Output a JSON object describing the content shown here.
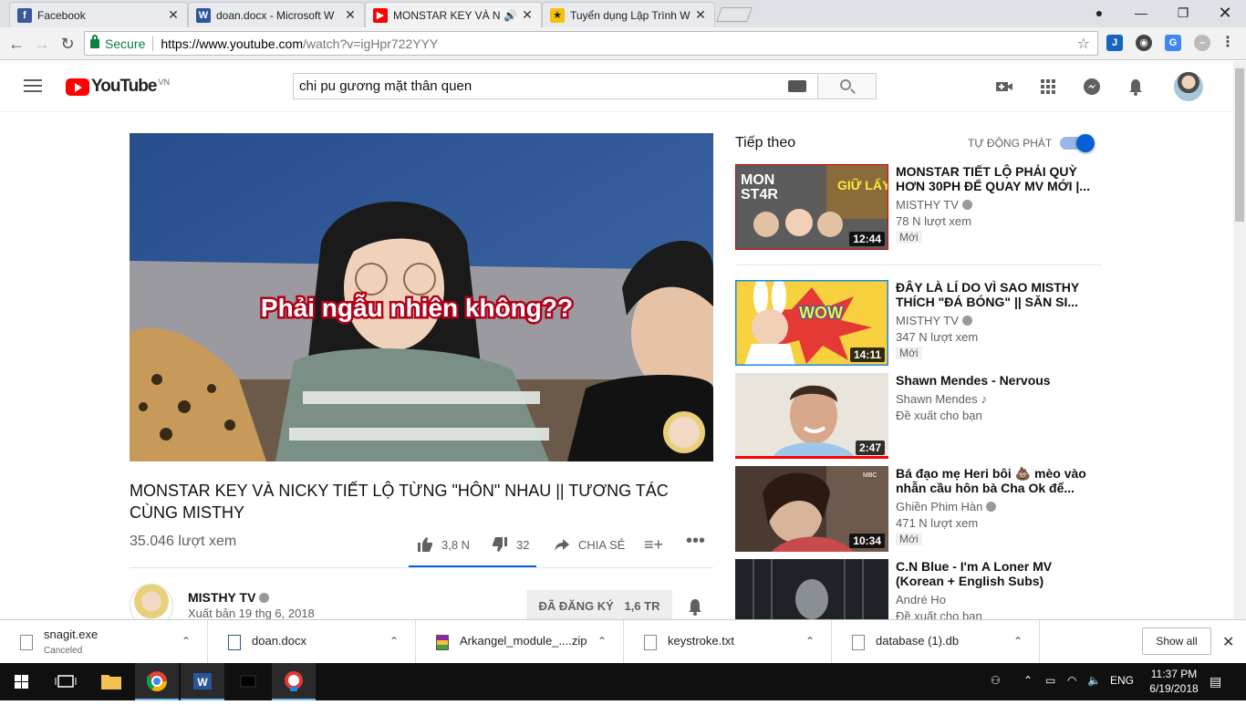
{
  "browser": {
    "tabs": [
      {
        "title": "Facebook",
        "icon": "facebook-icon",
        "color": "#3b5998",
        "active": false
      },
      {
        "title": "doan.docx - Microsoft W",
        "icon": "word-icon",
        "color": "#2b579a",
        "active": false
      },
      {
        "title": "MONSTAR KEY VÀ NIC",
        "icon": "youtube-icon",
        "color": "#ff0000",
        "active": true
      },
      {
        "title": "Tuyển dụng Lập Trình Wi",
        "icon": "jobs-icon",
        "color": "#f4c20d",
        "active": false
      }
    ],
    "secure_label": "Secure",
    "url_host": "https://www.youtube.com",
    "url_rest": "/watch?v=igHpr722YYY"
  },
  "youtube": {
    "logo_text": "YouTube",
    "country": "VN",
    "search_value": "chi pu gương mặt thân quen",
    "video": {
      "overlay_caption": "Phải ngẫu nhiên không??",
      "title": "MONSTAR KEY VÀ NICKY TIẾT LỘ TỪNG \"HÔN\" NHAU || TƯƠNG TÁC CÙNG MISTHY",
      "views": "35.046 lượt xem",
      "likes": "3,8 N",
      "dislikes": "32",
      "share_label": "CHIA SẺ"
    },
    "channel": {
      "name": "MISTHY TV",
      "published": "Xuất bản 19 thg 6, 2018",
      "subscribe_label": "ĐÃ ĐĂNG KÝ",
      "subscribers": "1,6 TR"
    },
    "upnext": {
      "heading": "Tiếp theo",
      "autoplay_label": "TỰ ĐỘNG PHÁT",
      "items": [
        {
          "title": "MONSTAR TIẾT LỘ PHẢI QUỲ HƠN 30PH ĐỂ QUAY MV MỚI |...",
          "channel": "MISTHY TV",
          "meta": "78 N lượt xem",
          "badge": "Mới",
          "duration": "12:44"
        },
        {
          "title": "ĐÂY LÀ LÍ DO VÌ SAO MISTHY THÍCH \"ĐÁ BÓNG\" || SĂN SI...",
          "channel": "MISTHY TV",
          "meta": "347 N lượt xem",
          "badge": "Mới",
          "duration": "14:11"
        },
        {
          "title": "Shawn Mendes - Nervous",
          "channel": "Shawn Mendes",
          "meta": "Đề xuất cho bạn",
          "badge": "",
          "duration": "2:47"
        },
        {
          "title": "Bá đạo mẹ Heri bôi 💩 mèo vào nhẫn cầu hôn bà Cha Ok để...",
          "channel": "Ghiền Phim Hàn",
          "meta": "471 N lượt xem",
          "badge": "Mới",
          "duration": "10:34"
        },
        {
          "title": "C.N Blue - I'm A Loner MV (Korean + English Subs)",
          "channel": "André Ho",
          "meta": "Đề xuất cho bạn",
          "badge": "",
          "duration": ""
        }
      ]
    }
  },
  "downloads": {
    "items": [
      {
        "name": "snagit.exe",
        "status": "Canceled"
      },
      {
        "name": "doan.docx",
        "status": ""
      },
      {
        "name": "Arkangel_module_....zip",
        "status": ""
      },
      {
        "name": "keystroke.txt",
        "status": ""
      },
      {
        "name": "database (1).db",
        "status": ""
      }
    ],
    "show_all": "Show all"
  },
  "taskbar": {
    "language": "ENG",
    "time": "11:37 PM",
    "date": "6/19/2018"
  }
}
